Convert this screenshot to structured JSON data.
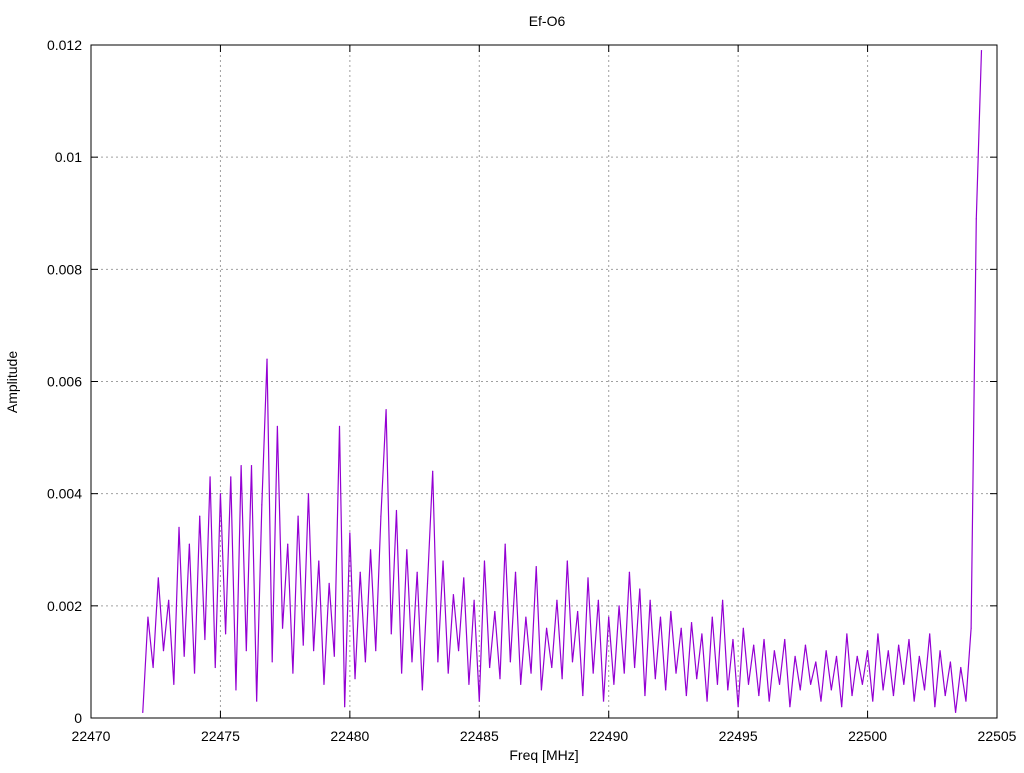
{
  "chart_data": {
    "type": "line",
    "title": "Ef-O6",
    "xlabel": "Freq [MHz]",
    "ylabel": "Amplitude",
    "xlim": [
      22470,
      22505
    ],
    "ylim": [
      0,
      0.012
    ],
    "grid": true,
    "xticks": [
      "22470",
      "22475",
      "22480",
      "22485",
      "22490",
      "22495",
      "22500",
      "22505"
    ],
    "xtick_values": [
      22470,
      22475,
      22480,
      22485,
      22490,
      22495,
      22500,
      22505
    ],
    "yticks": [
      "0",
      "0.002",
      "0.004",
      "0.006",
      "0.008",
      "0.01",
      "0.012"
    ],
    "ytick_values": [
      0,
      0.002,
      0.004,
      0.006,
      0.008,
      0.01,
      0.012
    ],
    "series": [
      {
        "name": "Ef-O6",
        "color": "#9400d3",
        "x_start": 22472.0,
        "x_step": 0.2,
        "values": [
          0.0001,
          0.0018,
          0.0009,
          0.0025,
          0.0012,
          0.0021,
          0.0006,
          0.0034,
          0.0011,
          0.0031,
          0.0008,
          0.0036,
          0.0014,
          0.0043,
          0.0009,
          0.004,
          0.0015,
          0.0043,
          0.0005,
          0.0045,
          0.0012,
          0.0045,
          0.0003,
          0.0038,
          0.0064,
          0.001,
          0.0052,
          0.0016,
          0.0031,
          0.0008,
          0.0036,
          0.0013,
          0.004,
          0.0012,
          0.0028,
          0.0006,
          0.0024,
          0.0011,
          0.0052,
          0.0002,
          0.0033,
          0.0007,
          0.0026,
          0.001,
          0.003,
          0.0012,
          0.0036,
          0.0055,
          0.0015,
          0.0037,
          0.0008,
          0.003,
          0.001,
          0.0026,
          0.0005,
          0.0024,
          0.0044,
          0.001,
          0.0028,
          0.0008,
          0.0022,
          0.0012,
          0.0025,
          0.0006,
          0.0021,
          0.0003,
          0.0028,
          0.0009,
          0.0019,
          0.0007,
          0.0031,
          0.001,
          0.0026,
          0.0006,
          0.0018,
          0.0008,
          0.0027,
          0.0005,
          0.0016,
          0.0009,
          0.0021,
          0.0007,
          0.0028,
          0.001,
          0.0019,
          0.0004,
          0.0025,
          0.0008,
          0.0021,
          0.0003,
          0.0018,
          0.0006,
          0.002,
          0.0008,
          0.0026,
          0.0009,
          0.0023,
          0.0004,
          0.0021,
          0.0007,
          0.0018,
          0.0005,
          0.0019,
          0.0008,
          0.0016,
          0.0004,
          0.0017,
          0.0007,
          0.0015,
          0.0003,
          0.0018,
          0.0006,
          0.0021,
          0.0005,
          0.0014,
          0.0002,
          0.0016,
          0.0006,
          0.0013,
          0.0004,
          0.0014,
          0.0003,
          0.0012,
          0.0006,
          0.0014,
          0.0002,
          0.0011,
          0.0005,
          0.0013,
          0.0006,
          0.001,
          0.0003,
          0.0012,
          0.0005,
          0.0011,
          0.0002,
          0.0015,
          0.0004,
          0.0011,
          0.0006,
          0.0012,
          0.0003,
          0.0015,
          0.0005,
          0.0012,
          0.0004,
          0.0013,
          0.0006,
          0.0014,
          0.0003,
          0.0011,
          0.0005,
          0.0015,
          0.0002,
          0.0012,
          0.0004,
          0.001,
          0.0001,
          0.0009,
          0.0003,
          0.0016,
          0.0089,
          0.0119
        ]
      }
    ]
  }
}
